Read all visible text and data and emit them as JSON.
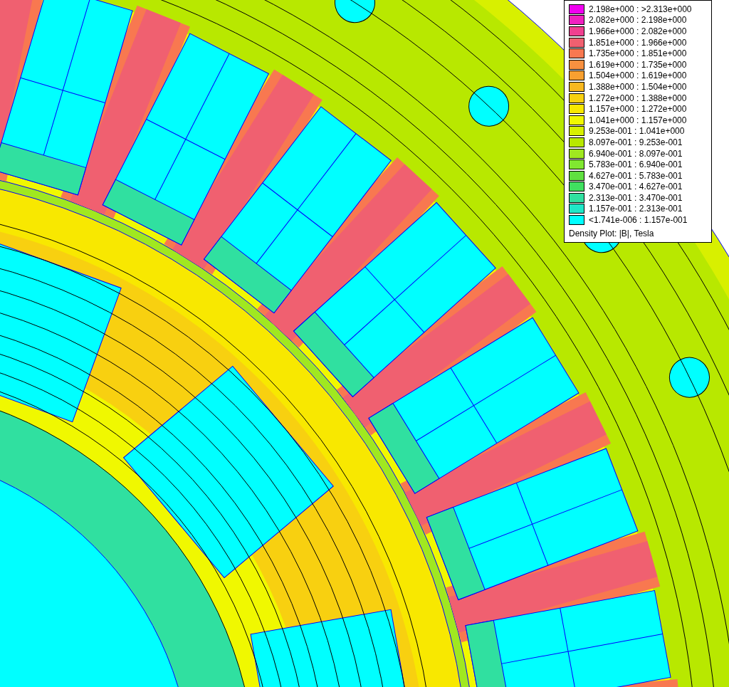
{
  "legend": {
    "ranges": [
      {
        "label": "2.198e+000 : >2.313e+000",
        "color": "#f000f0"
      },
      {
        "label": "2.082e+000 : 2.198e+000",
        "color": "#f020c0"
      },
      {
        "label": "1.966e+000 : 2.082e+000",
        "color": "#f04090"
      },
      {
        "label": "1.851e+000 : 1.966e+000",
        "color": "#f06070"
      },
      {
        "label": "1.735e+000 : 1.851e+000",
        "color": "#f87850"
      },
      {
        "label": "1.619e+000 : 1.735e+000",
        "color": "#f89040"
      },
      {
        "label": "1.504e+000 : 1.619e+000",
        "color": "#f8a030"
      },
      {
        "label": "1.388e+000 : 1.504e+000",
        "color": "#f8b820"
      },
      {
        "label": "1.272e+000 : 1.388e+000",
        "color": "#f8d010"
      },
      {
        "label": "1.157e+000 : 1.272e+000",
        "color": "#f8e800"
      },
      {
        "label": "1.041e+000 : 1.157e+000",
        "color": "#f0f800"
      },
      {
        "label": "9.253e-001 : 1.041e+000",
        "color": "#d8f000"
      },
      {
        "label": "8.097e-001 : 9.253e-001",
        "color": "#b8e800"
      },
      {
        "label": "6.940e-001 : 8.097e-001",
        "color": "#a0e820"
      },
      {
        "label": "5.783e-001 : 6.940e-001",
        "color": "#80e830"
      },
      {
        "label": "4.627e-001 : 5.783e-001",
        "color": "#60e040"
      },
      {
        "label": "3.470e-001 : 4.627e-001",
        "color": "#40e060"
      },
      {
        "label": "2.313e-001 : 3.470e-001",
        "color": "#30e0a0"
      },
      {
        "label": "1.157e-001 : 2.313e-001",
        "color": "#20e8c8"
      },
      {
        "label": "<1.741e-006 : 1.157e-001",
        "color": "#00ffff"
      }
    ],
    "caption": "Density Plot: |B|, Tesla"
  }
}
